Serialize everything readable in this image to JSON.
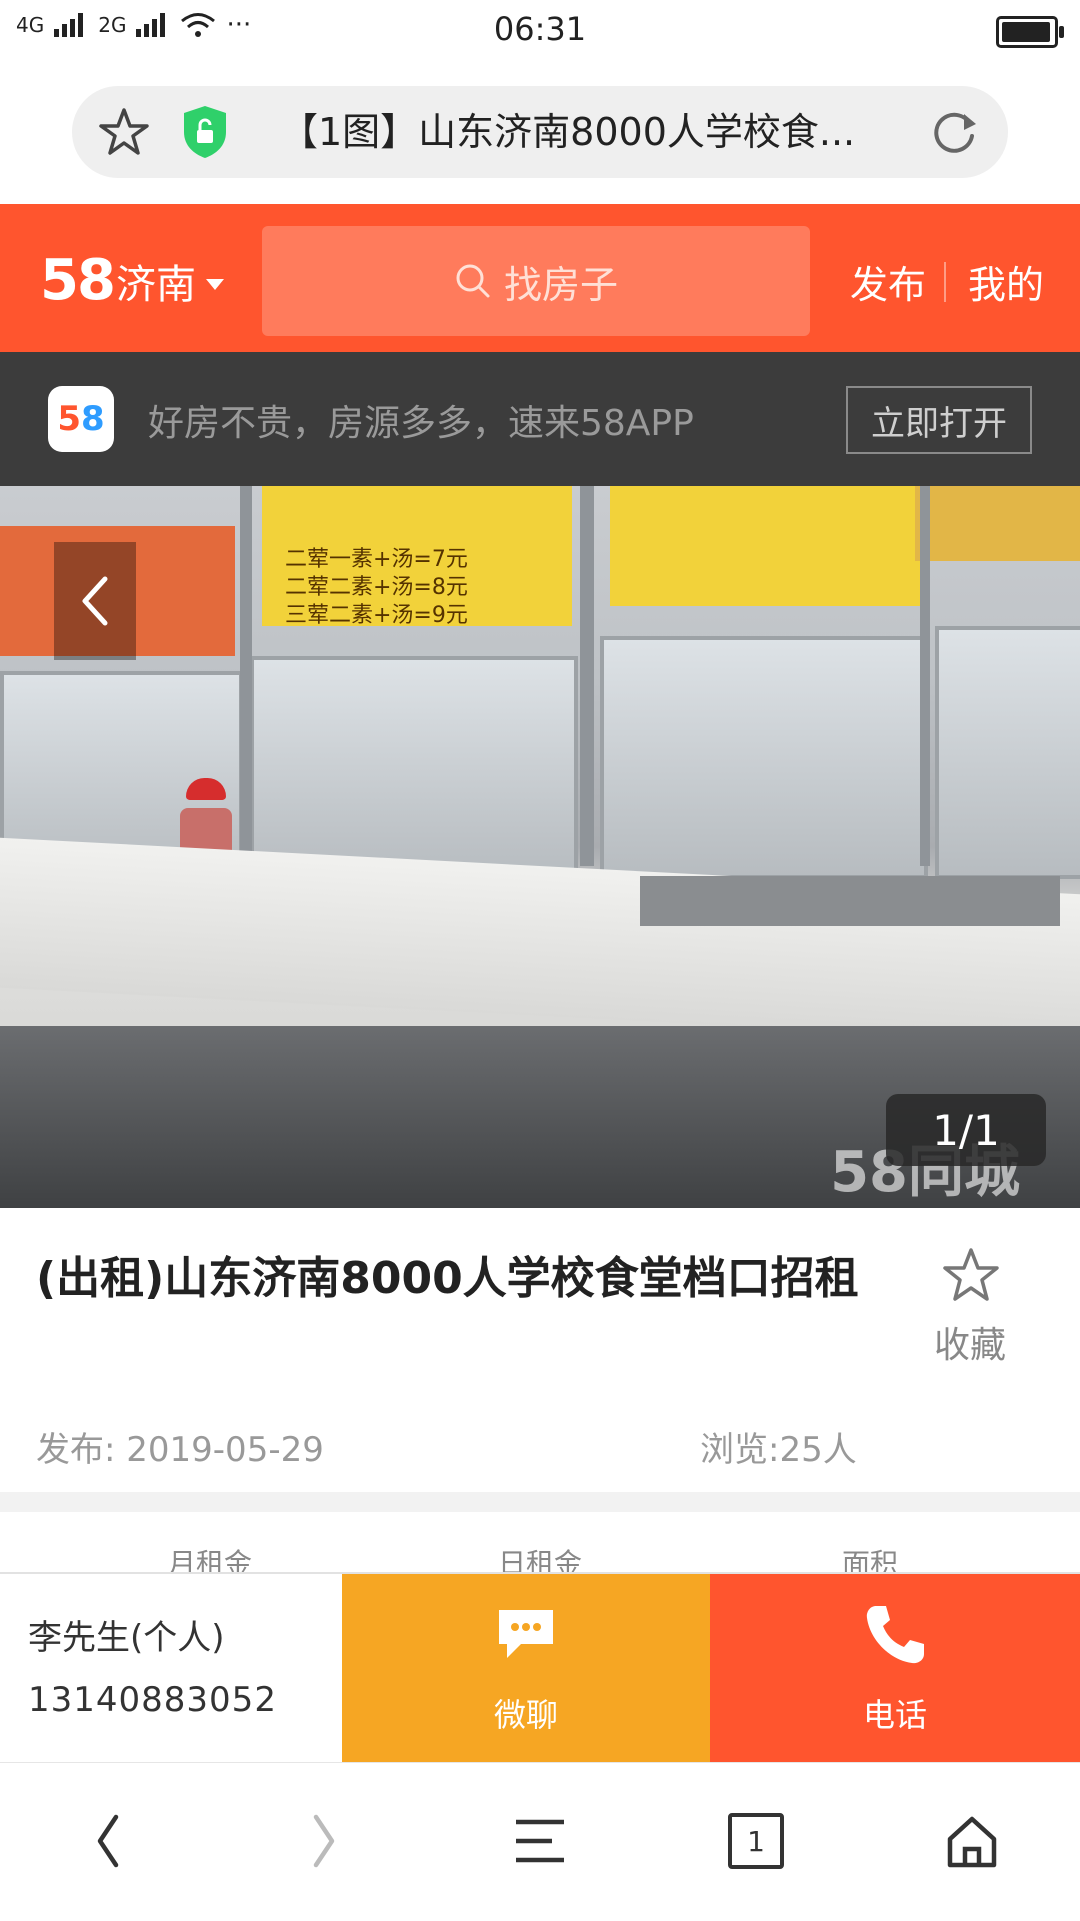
{
  "status_bar": {
    "signal_1": "4G",
    "signal_2": "2G",
    "more": "···",
    "time": "06:31",
    "battery_level": 0.95
  },
  "browser": {
    "page_title": "【1图】山东济南8000人学校食...",
    "favorite_icon": "star-icon",
    "security_icon": "shield-icon",
    "reload_icon": "reload-icon"
  },
  "header": {
    "logo": "58",
    "city": "济南",
    "search_placeholder": "找房子",
    "publish": "发布",
    "mine": "我的",
    "brand_color": "#ff552e"
  },
  "app_banner": {
    "icon_text_1": "5",
    "icon_text_2": "8",
    "text": "好房不贵，房源多多，速来58APP",
    "open_button": "立即打开"
  },
  "gallery": {
    "counter": "1/1",
    "watermark": "58同城",
    "signs": [
      "二荤一素+汤=7元",
      "二荤二素+汤=8元",
      "三荤二素+汤=9元"
    ]
  },
  "listing": {
    "title": "(出租)山东济南8000人学校食堂档口招租",
    "favorite_label": "收藏",
    "date": "发布: 2019-05-29",
    "views": "浏览:25人"
  },
  "stats": {
    "labels": [
      "月租金",
      "日租金",
      "面积"
    ]
  },
  "contact": {
    "name": "李先生(个人)",
    "phone": "13140883052",
    "chat_label": "微聊",
    "call_label": "电话",
    "chat_color": "#f6a623",
    "call_color": "#ff552e"
  },
  "bottom_nav": {
    "tab_count": "1"
  }
}
